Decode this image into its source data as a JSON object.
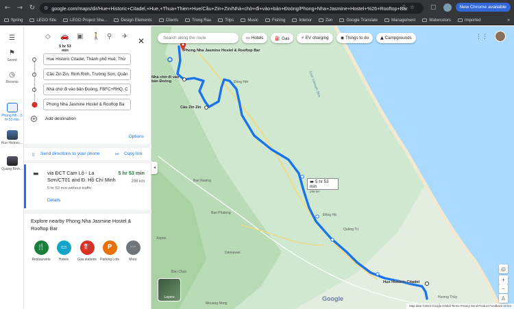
{
  "browser": {
    "url": "google.com/maps/dir/Hue+Historic+Citadel,+Hue,+Thua+Thien+Hue/Cầu+Zin+Zin/Nhà+chờ+đi+vào+bản+Đoòng/Phong+Nha+Jasmine+Hostel+%26+Rooftop+Bar/@17.0...",
    "chrome_button": "New Chrome available",
    "bookmarks": [
      "Spring",
      "LEGO Site",
      "LEGO Project Sha...",
      "Design Elements",
      "Clients",
      "Trong Rau",
      "Trips",
      "Music",
      "Fishing",
      "Interior",
      "Zen",
      "Google Translate",
      "Management",
      "Watercolors",
      "Imported"
    ]
  },
  "rail": {
    "menu_icon": "menu-icon",
    "saved": "Saved",
    "recents": "Recents",
    "thumb1_label": "Phong Nh... 5 hr 53 min",
    "thumb2_label": "Hue Historic...",
    "thumb3_label": "Quang Bình..."
  },
  "modes": {
    "drive_time": "5 hr 53 min"
  },
  "stops": [
    "Hue Historic Citadel, Thành phố Huế, Thừ",
    "Cầu Zin Zin, Rinh Rinh, Trường Sơn, Quản",
    "Nhà chờ đi vào bản Đoòng, FBFC+RHQ, C",
    "Phong Nha Jasmine Hostel & Rooftop Ba"
  ],
  "add_destination": "Add destination",
  "options": "Options",
  "send_directions": "Send directions to your phone",
  "copy_link": "Copy link",
  "route": {
    "title": "via ĐCT Cam Lộ - La Sơn/CT01 and Đ. Hồ Chí Minh",
    "time": "5 hr 53 min",
    "distance": "298 km",
    "note": "5 hr 53 min without traffic",
    "details": "Details"
  },
  "explore": {
    "title": "Explore nearby Phong Nha Jasmine Hostel & Rooftop Bar",
    "categories": [
      {
        "label": "Restaurants",
        "color": "#188038",
        "icon": "fork-knife-icon"
      },
      {
        "label": "Hotels",
        "color": "#12a4c8",
        "icon": "bed-icon"
      },
      {
        "label": "Gas stations",
        "color": "#d93025",
        "icon": "gas-pump-icon"
      },
      {
        "label": "Parking Lots",
        "color": "#e8710a",
        "icon": "parking-icon"
      },
      {
        "label": "More",
        "color": "#70757a",
        "icon": "more-icon"
      }
    ]
  },
  "map": {
    "search_placeholder": "Search along the route",
    "chips": [
      "Hotels",
      "Gas",
      "EV charging",
      "Things to do",
      "Campgrounds"
    ],
    "route_box_time": "5 hr 53 min",
    "route_box_dist": "298 km",
    "labels": {
      "dest": "Phong Nha Jasmine Hostel & Rooftop Bar",
      "wait": "Nhà chờ đi vào bản Đoòng",
      "bridge": "Cầu Zin Zin",
      "origin": "Hue Historic Citadel",
      "dong_hoi": "Đồng Hới",
      "dong_ha": "Đông Hà",
      "quang_tri": "Quảng Trị",
      "huong_thuy": "Hương Thủy",
      "ban_raving": "Ban Raving",
      "ban_phalong": "Ban Phalong",
      "xepon": "Xepon",
      "dansavan": "Dansavan",
      "ban_chan": "Ban Chan",
      "mouang_nong": "Mouang Nong",
      "sea": "East Vietnam Sea"
    },
    "layers": "Layers",
    "footer": "Map data ©2024 Google   Global   Terms   Privacy   Send Product Feedback   10 km",
    "google": "Google"
  }
}
